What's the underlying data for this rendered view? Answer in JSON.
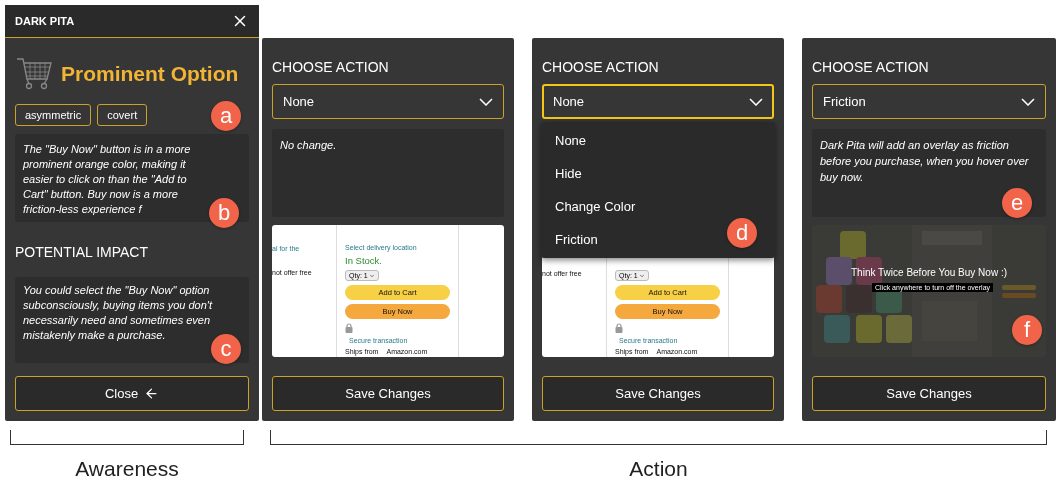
{
  "awareness_panel": {
    "title": "DARK PITA",
    "pattern_name": "Prominent Option",
    "tags": [
      "asymmetric",
      "covert"
    ],
    "tags_callout": "a",
    "description": "The \"Buy Now\" button is in a more prominent orange color, making it easier to click on than the \"Add to Cart\" button. Buy now is a more friction-less experience f",
    "description_callout": "b",
    "impact_heading": "POTENTIAL IMPACT",
    "impact": "You could select the \"Buy Now\" option subconsciously, buying items you don't necessarily need and sometimes even mistakenly make a purchase.",
    "impact_callout": "c",
    "close_button": "Close"
  },
  "action_panels": [
    {
      "heading": "CHOOSE ACTION",
      "select_value": "None",
      "focused": false,
      "description": "No change.",
      "preview": {
        "kind": "product",
        "left_texts": [
          "al for the",
          "not offer free"
        ],
        "location": "Select delivery location",
        "stock": "In Stock.",
        "qty": "Qty: 1",
        "add_button": "Add to Cart",
        "buy_button": "Buy Now",
        "secure": "Secure transaction",
        "ships_label": "Ships from",
        "ships_value": "Amazon.com"
      },
      "save_button": "Save Changes"
    },
    {
      "heading": "CHOOSE ACTION",
      "select_value": "None",
      "focused": true,
      "menu": {
        "options": [
          "None",
          "Hide",
          "Change Color",
          "Friction"
        ],
        "callout": "d"
      },
      "preview": {
        "kind": "product",
        "left_texts": [
          "not offer free"
        ],
        "qty": "Qty: 1",
        "add_button": "Add to Cart",
        "buy_button": "Buy Now",
        "secure": "Secure transaction",
        "ships_label": "Ships from",
        "ships_value": "Amazon.com"
      },
      "save_button": "Save Changes"
    },
    {
      "heading": "CHOOSE ACTION",
      "select_value": "Friction",
      "focused": false,
      "description": "Dark Pita will add an overlay as friction before you purchase, when you hover over buy now.",
      "description_callout": "e",
      "preview": {
        "kind": "overlay",
        "message": "Think Twice Before You Buy Now :)",
        "hint": "Click anywhere to turn off the overlay",
        "callout": "f"
      },
      "save_button": "Save Changes"
    }
  ],
  "brackets": [
    {
      "label": "Awareness"
    },
    {
      "label": "Action"
    }
  ]
}
